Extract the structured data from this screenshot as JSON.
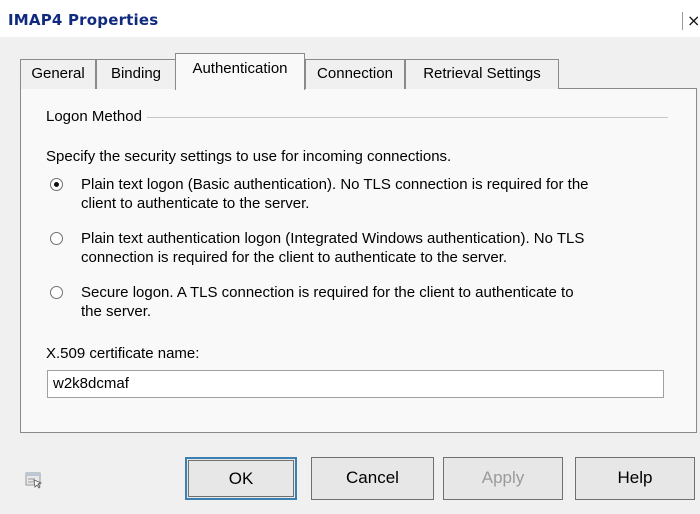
{
  "window": {
    "title": "IMAP4 Properties",
    "close_glyph": "×"
  },
  "tabs": [
    {
      "label": "General",
      "active": false
    },
    {
      "label": "Binding",
      "active": false
    },
    {
      "label": "Authentication",
      "active": true
    },
    {
      "label": "Connection",
      "active": false
    },
    {
      "label": "Retrieval Settings",
      "active": false
    }
  ],
  "logon": {
    "group_title": "Logon Method",
    "description": "Specify the security settings to use for incoming connections.",
    "options": [
      {
        "line1": "Plain text logon (Basic authentication). No TLS connection is required for the",
        "line2": "client to authenticate to the server.",
        "checked": true
      },
      {
        "line1": "Plain text authentication logon (Integrated Windows authentication). No TLS",
        "line2": "connection is required for the client to authenticate to the server.",
        "checked": false
      },
      {
        "line1": "Secure logon. A TLS connection is required for the client to authenticate to",
        "line2": "the server.",
        "checked": false
      }
    ]
  },
  "certificate": {
    "label": "X.509 certificate name:",
    "value": "w2k8dcmaf"
  },
  "buttons": {
    "ok": "OK",
    "cancel": "Cancel",
    "apply": "Apply",
    "help": "Help"
  },
  "icons": {
    "help": "context-help-icon"
  }
}
